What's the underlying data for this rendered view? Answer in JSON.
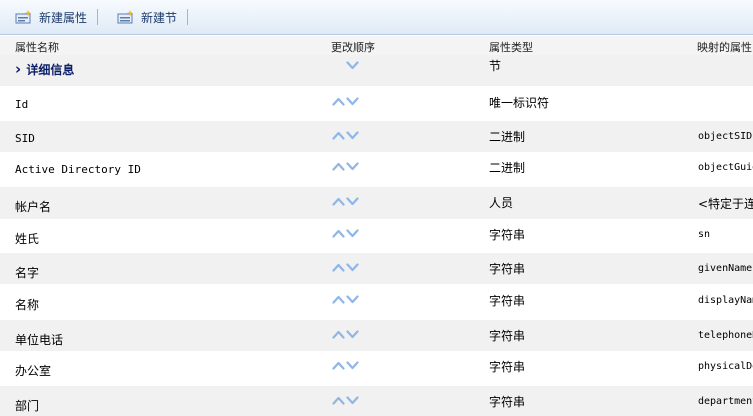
{
  "toolbar": {
    "new_property": "新建属性",
    "new_section": "新建节"
  },
  "columns": {
    "name": "属性名称",
    "order": "更改顺序",
    "type": "属性类型",
    "mapped": "映射的属性"
  },
  "rows": [
    {
      "name": "详细信息",
      "type": "节",
      "mapped": "",
      "kind": "section",
      "up": false,
      "down": true
    },
    {
      "name": "Id",
      "type": "唯一标识符",
      "mapped": "",
      "kind": "item",
      "up": true,
      "down": true
    },
    {
      "name": "SID",
      "type": "二进制",
      "mapped": "objectSID",
      "kind": "item",
      "up": true,
      "down": true
    },
    {
      "name": "Active Directory ID",
      "type": "二进制",
      "mapped": "objectGuid",
      "kind": "item",
      "up": true,
      "down": true
    },
    {
      "name": "帐户名",
      "type": "人员",
      "mapped": "<特定于连接",
      "kind": "item",
      "up": true,
      "down": true
    },
    {
      "name": "姓氏",
      "type": "字符串",
      "mapped": "sn",
      "kind": "item",
      "up": true,
      "down": true
    },
    {
      "name": "名字",
      "type": "字符串",
      "mapped": "givenName",
      "kind": "item",
      "up": true,
      "down": true
    },
    {
      "name": "名称",
      "type": "字符串",
      "mapped": "displayName",
      "kind": "item",
      "up": true,
      "down": true
    },
    {
      "name": "单位电话",
      "type": "字符串",
      "mapped": "telephoneNumber",
      "kind": "item",
      "up": true,
      "down": true
    },
    {
      "name": "办公室",
      "type": "字符串",
      "mapped": "physicalDeliveryOfficeName",
      "kind": "item",
      "up": true,
      "down": true
    },
    {
      "name": "部门",
      "type": "字符串",
      "mapped": "department",
      "kind": "item",
      "up": true,
      "down": true
    }
  ],
  "colors": {
    "arrow": "#8fb6e6",
    "section_text": "#0d1f66",
    "alt_row": "#f1f1f1"
  }
}
